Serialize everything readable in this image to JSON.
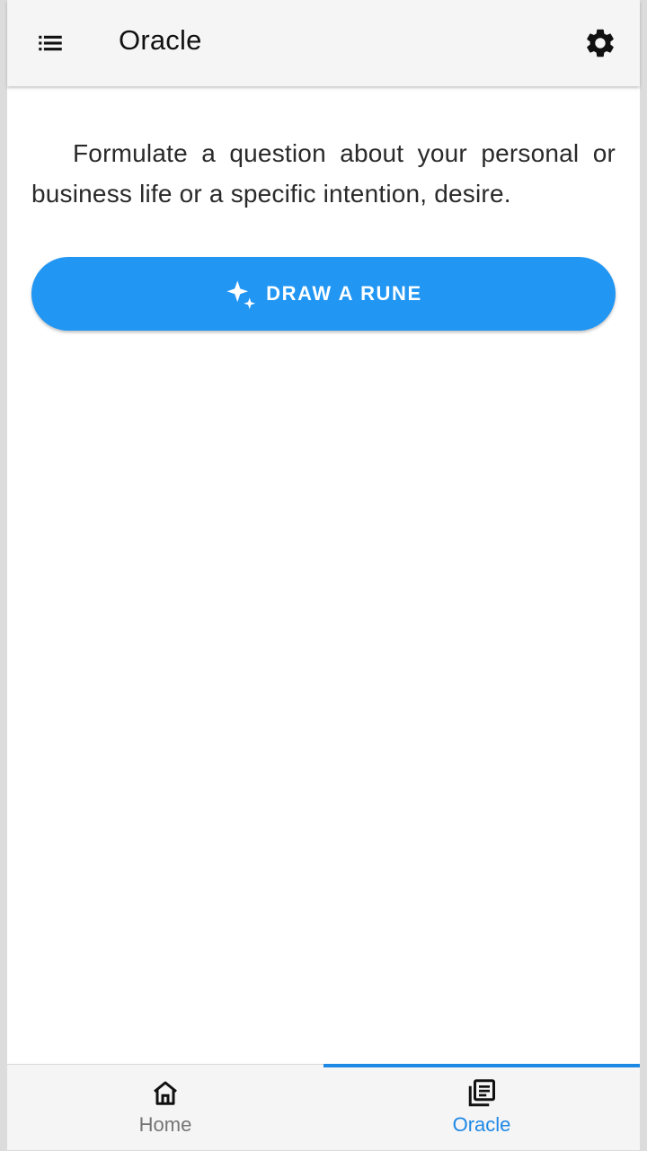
{
  "colors": {
    "accent": "#2196f3",
    "active_tab": "#1e88e5",
    "inactive_tab": "#757575",
    "appbar_bg": "#f5f5f5"
  },
  "appbar": {
    "title": "Oracle",
    "menu_icon": "list-menu-icon",
    "settings_icon": "gear-icon"
  },
  "main": {
    "prompt": "Formulate a question about your personal or business life or a specific intention, desire.",
    "draw_button": {
      "label": "DRAW A RUNE",
      "icon": "sparkle-icon"
    }
  },
  "bottom_nav": {
    "active_index": 1,
    "tabs": [
      {
        "label": "Home",
        "icon": "home-icon"
      },
      {
        "label": "Oracle",
        "icon": "article-icon"
      }
    ]
  }
}
